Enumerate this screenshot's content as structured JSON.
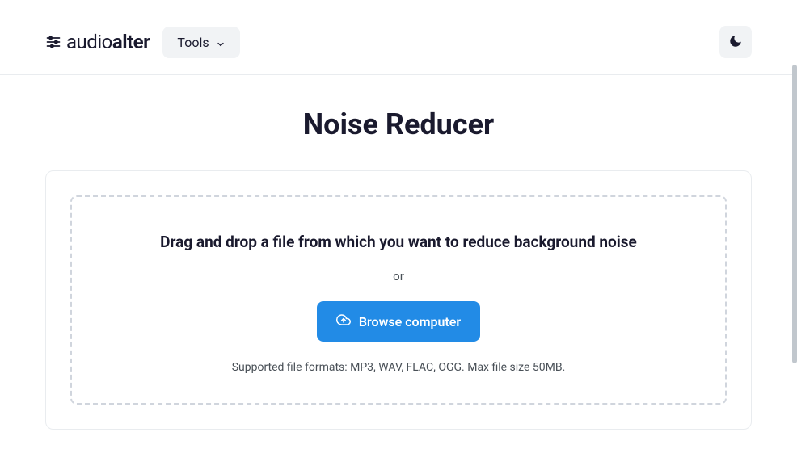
{
  "brand": {
    "name_light": "audio",
    "name_bold": "alter"
  },
  "nav": {
    "tools_label": "Tools"
  },
  "page": {
    "title": "Noise Reducer"
  },
  "dropzone": {
    "instruction": "Drag and drop a file from which you want to reduce background noise",
    "or_label": "or",
    "browse_label": "Browse computer",
    "supported_text": "Supported file formats: MP3, WAV, FLAC, OGG. Max file size 50MB."
  }
}
